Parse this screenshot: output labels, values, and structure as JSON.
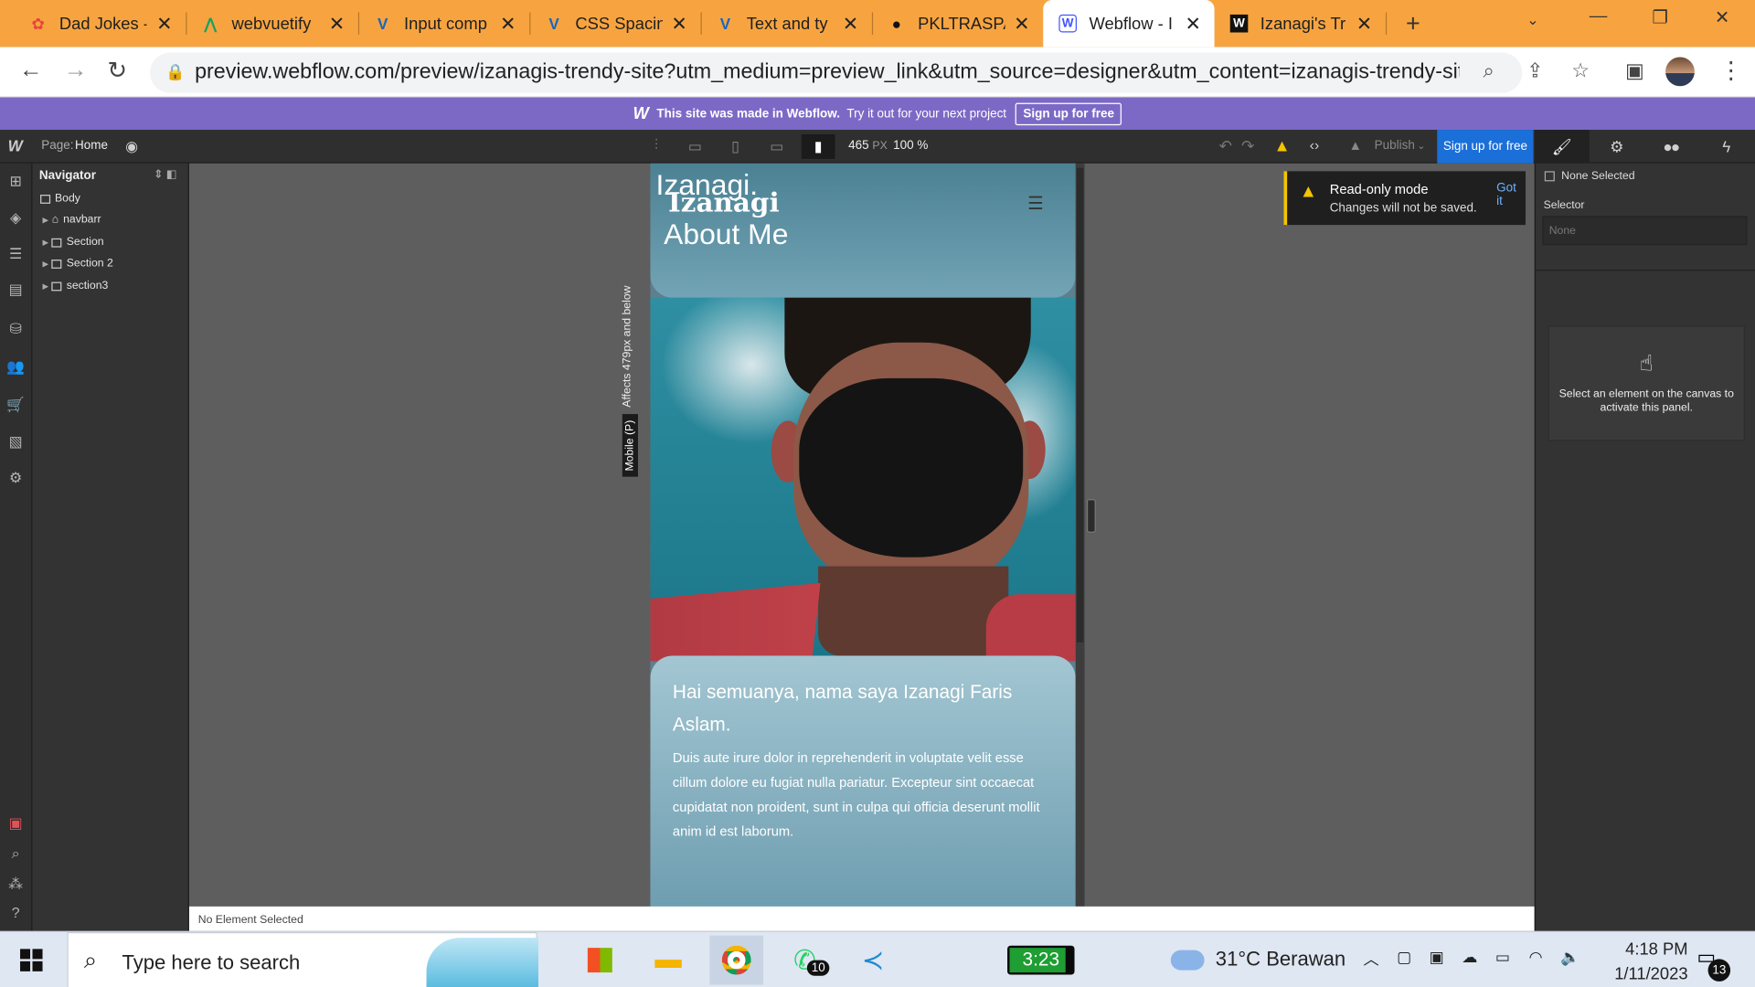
{
  "browser": {
    "tabs": [
      {
        "title": "Dad Jokes - ",
        "icon": "dad-jokes-icon",
        "color": "#e8453c"
      },
      {
        "title": "webvuetify",
        "icon": "vuetify-icon",
        "color": "#1aa260"
      },
      {
        "title": "Input comp",
        "icon": "vuetify-v-icon",
        "color": "#1867c0"
      },
      {
        "title": "CSS Spacin",
        "icon": "vuetify-v-icon",
        "color": "#1867c0"
      },
      {
        "title": "Text and ty",
        "icon": "vuetify-v-icon",
        "color": "#1867c0"
      },
      {
        "title": "PKLTRASPA",
        "icon": "github-icon",
        "color": "#111111"
      },
      {
        "title": "Webflow - I",
        "icon": "webflow-icon",
        "color": "#4353ff"
      },
      {
        "title": "Izanagi's Tr",
        "icon": "webflow-icon",
        "color": "#111111"
      }
    ],
    "url": "preview.webflow.com/preview/izanagis-trendy-site?utm_medium=preview_link&utm_source=designer&utm_content=izanagis-trendy-site&preview..."
  },
  "banner": {
    "text_bold": "This site was made in Webflow.",
    "text": "Try it out for your next project",
    "button": "Sign up for free"
  },
  "designer": {
    "page_label": "Page:",
    "page_name": "Home",
    "width_value": "465",
    "width_unit": "PX",
    "zoom": "100 %",
    "publish": "Publish",
    "signup": "Sign up for free"
  },
  "navigator": {
    "title": "Navigator",
    "items": [
      "Body",
      "navbarr",
      "Section",
      "Section 2",
      "section3"
    ]
  },
  "canvas": {
    "breakpoint_label": "Mobile (P)",
    "affects_label": "Affects 479px and below",
    "site": {
      "logo_a": "Izanagi.",
      "logo_b": "Izanagi",
      "heading": "About Me",
      "card_title": "Hai semuanya, nama saya Izanagi Faris Aslam.",
      "card_text": "Duis aute irure dolor in reprehenderit in voluptate velit esse cillum dolore eu fugiat nulla pariatur. Excepteur sint occaecat cupidatat non proident, sunt in culpa qui officia deserunt mollit anim id est laborum."
    },
    "toast": {
      "title": "Read-only mode",
      "text": "Changes will not be saved.",
      "action": "Got it"
    },
    "status": "No Element Selected"
  },
  "style_panel": {
    "none_selected": "None Selected",
    "selector_label": "Selector",
    "selector_placeholder": "None",
    "hint": "Select an element on the canvas to activate this panel."
  },
  "taskbar": {
    "search_placeholder": "Type here to search",
    "whatsapp_badge": "10",
    "battery_time": "3:23",
    "temperature": "31°C",
    "weather": "Berawan",
    "time": "4:18 PM",
    "date": "1/11/2023",
    "notifications": "13"
  }
}
